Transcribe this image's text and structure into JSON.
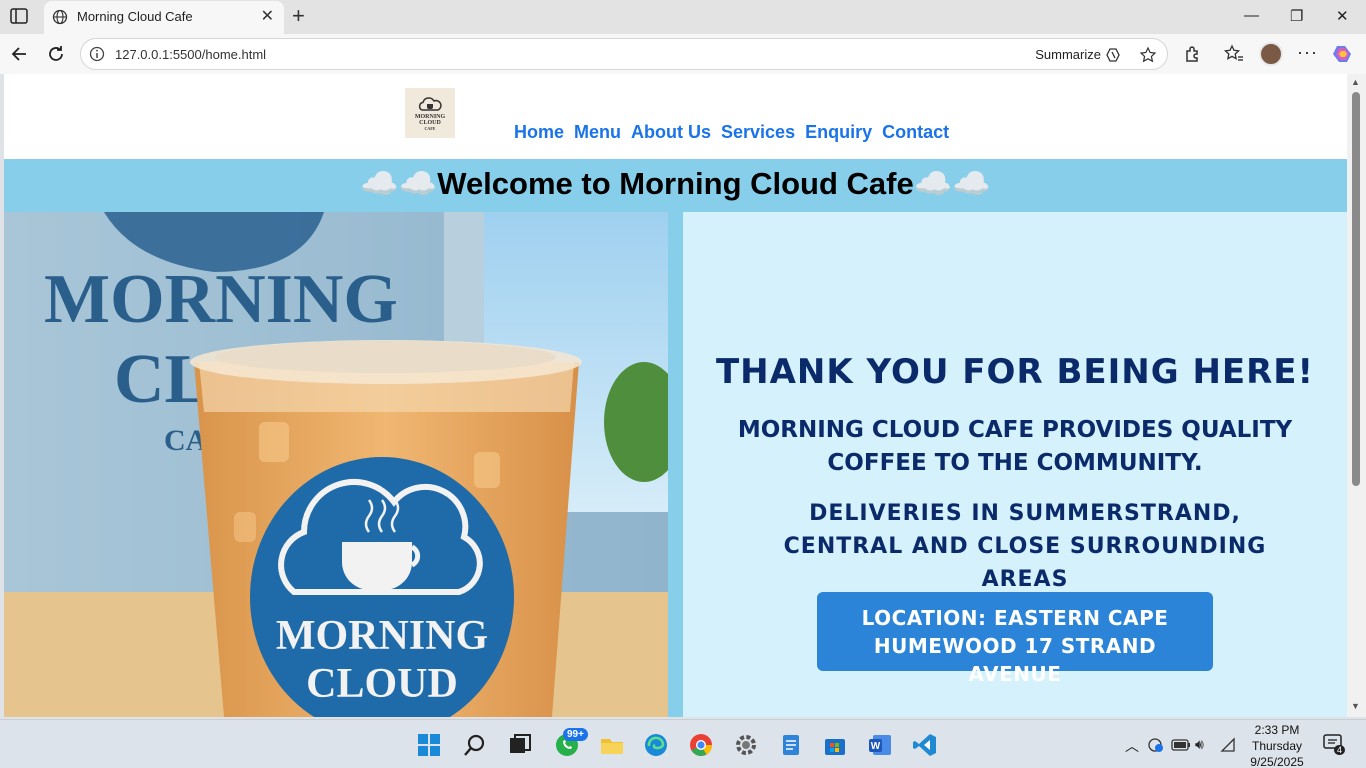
{
  "browser": {
    "tab_title": "Morning Cloud Cafe",
    "url": "127.0.0.1:5500/home.html",
    "summarize_label": "Summarize"
  },
  "site": {
    "logo_text_line1": "MORNING",
    "logo_text_line2": "CLOUD",
    "logo_text_line3": "CAFE",
    "nav": [
      "Home",
      "Menu",
      "About Us",
      "Services",
      "Enquiry",
      "Contact"
    ],
    "banner_title": "☁️☁️Welcome to Morning Cloud Cafe☁️☁️",
    "heading": "THANK YOU FOR BEING HERE!",
    "tagline": "MORNING CLOUD CAFE PROVIDES QUALITY COFFEE TO THE COMMUNITY.",
    "deliveries": "DELIVERIES IN SUMMERSTRAND, CENTRAL AND CLOSE SURROUNDING AREAS",
    "location_line1": "LOCATION: EASTERN CAPE",
    "location_line2": "HUMEWOOD 17 STRAND AVENUE",
    "hero_cup_text1": "MORNING",
    "hero_cup_text2": "CLOUD",
    "hero_sign_text1": "MORNING",
    "hero_sign_text2": "CL",
    "hero_sign_text3": "CA"
  },
  "taskbar": {
    "whatsapp_badge": "99+",
    "time": "2:33 PM",
    "day": "Thursday",
    "date": "9/25/2025",
    "notifications": "4"
  },
  "colors": {
    "banner": "#87ceeb",
    "nav_link": "#1a73e8",
    "panel_bg": "#d4f1fc",
    "heading_text": "#0b2a6a",
    "location_button": "#2b84d8"
  }
}
